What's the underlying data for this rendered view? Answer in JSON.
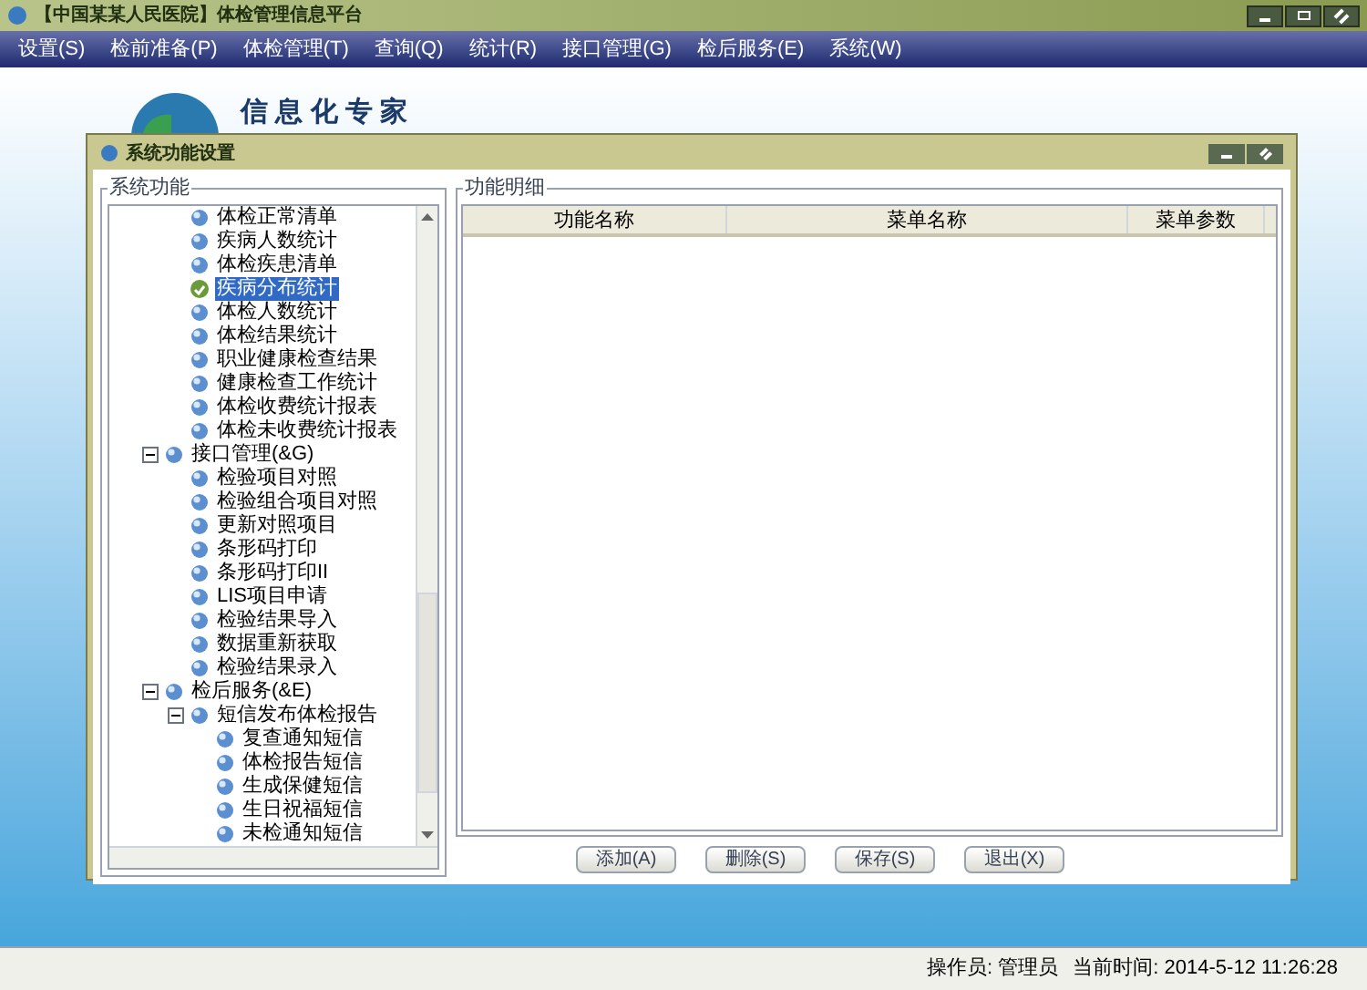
{
  "app_title": "【中国某某人民医院】体检管理信息平台",
  "menu": [
    "设置(S)",
    "检前准备(P)",
    "体检管理(T)",
    "查询(Q)",
    "统计(R)",
    "接口管理(G)",
    "检后服务(E)",
    "系统(W)"
  ],
  "slogan": "信 息 化 专 家",
  "dialog": {
    "title": "系统功能设置",
    "left_group": "系统功能",
    "tree": [
      {
        "children": [
          {
            "label": "体检正常清单",
            "selected": false
          },
          {
            "label": "疾病人数统计",
            "selected": false
          },
          {
            "label": "体检疾患清单",
            "selected": false
          },
          {
            "label": "疾病分布统计",
            "selected": true
          },
          {
            "label": "体检人数统计",
            "selected": false
          },
          {
            "label": "体检结果统计",
            "selected": false
          },
          {
            "label": "职业健康检查结果",
            "selected": false
          },
          {
            "label": "健康检查工作统计",
            "selected": false
          },
          {
            "label": "体检收费统计报表",
            "selected": false
          },
          {
            "label": "体检未收费统计报表",
            "selected": false
          }
        ]
      },
      {
        "label": "接口管理(&G)",
        "expanded": true,
        "selected": false,
        "children": [
          {
            "label": "检验项目对照",
            "selected": false
          },
          {
            "label": "检验组合项目对照",
            "selected": false
          },
          {
            "label": "更新对照项目",
            "selected": false
          },
          {
            "label": "条形码打印",
            "selected": false
          },
          {
            "label": "条形码打印II",
            "selected": false
          },
          {
            "label": "LIS项目申请",
            "selected": false
          },
          {
            "label": "检验结果导入",
            "selected": false
          },
          {
            "label": "数据重新获取",
            "selected": false
          },
          {
            "label": "检验结果录入",
            "selected": false
          }
        ]
      },
      {
        "label": "检后服务(&E)",
        "expanded": true,
        "selected": false,
        "children": [
          {
            "label": "短信发布体检报告",
            "expanded": true,
            "selected": false,
            "children": [
              {
                "label": "复查通知短信",
                "selected": false
              },
              {
                "label": "体检报告短信",
                "selected": false
              },
              {
                "label": "生成保健短信",
                "selected": false
              },
              {
                "label": "生日祝福短信",
                "selected": false
              },
              {
                "label": "未检通知短信",
                "selected": false
              }
            ]
          }
        ]
      }
    ],
    "right_group": "功能明细",
    "columns": [
      "功能名称",
      "菜单名称",
      "菜单参数"
    ],
    "buttons": [
      "添加(A)",
      "删除(S)",
      "保存(S)",
      "退出(X)"
    ]
  },
  "status_bar": {
    "operator": "操作员: 管理员",
    "time": "当前时间: 2014-5-12 11:26:28"
  }
}
